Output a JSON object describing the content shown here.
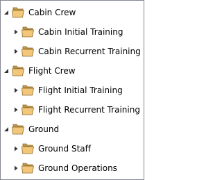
{
  "tree": {
    "groups": [
      {
        "label": "Cabin Crew",
        "expanded": true,
        "icon": "folder-icon",
        "children": [
          {
            "label": "Cabin Initial Training",
            "expanded": false,
            "icon": "folder-icon"
          },
          {
            "label": "Cabin Recurrent Training",
            "expanded": false,
            "icon": "folder-icon"
          }
        ]
      },
      {
        "label": "Flight Crew",
        "expanded": true,
        "icon": "folder-icon",
        "children": [
          {
            "label": "Flight Initial Training",
            "expanded": false,
            "icon": "folder-icon"
          },
          {
            "label": "Flight Recurrent Training",
            "expanded": false,
            "icon": "folder-icon"
          }
        ]
      },
      {
        "label": "Ground",
        "expanded": true,
        "icon": "folder-icon",
        "children": [
          {
            "label": "Ground Staff",
            "expanded": false,
            "icon": "folder-icon"
          },
          {
            "label": "Ground Operations",
            "expanded": false,
            "icon": "folder-icon"
          }
        ]
      }
    ]
  },
  "colors": {
    "border": "#828790",
    "folder_front": "#F2C779",
    "folder_back": "#C79A46",
    "folder_outline": "#8B6A2E",
    "arrow": "#333333"
  }
}
